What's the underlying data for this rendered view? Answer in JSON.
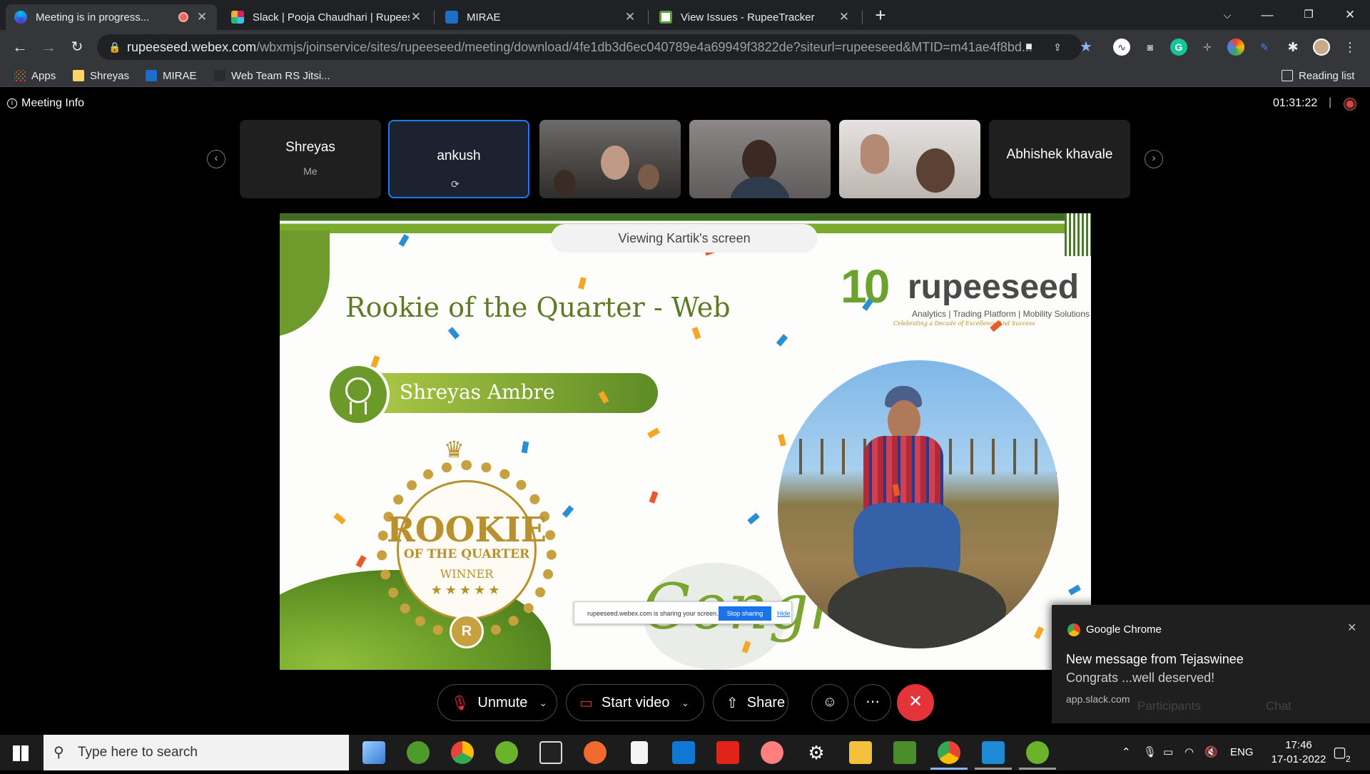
{
  "tabs": [
    {
      "title": "Meeting is in progress...",
      "active": true
    },
    {
      "title": "Slack | Pooja Chaudhari | Rupeese",
      "active": false
    },
    {
      "title": "MIRAE",
      "active": false
    },
    {
      "title": "View Issues - RupeeTracker",
      "active": false
    }
  ],
  "address": {
    "host": "rupeeseed.webex.com",
    "path": "/wbxmjs/joinservice/sites/rupeeseed/meeting/download/4fe1db3d6ec040789e4a69949f3822de?siteurl=rupeeseed&MTID=m41ae4f8bd..."
  },
  "bookmarks": [
    "Apps",
    "Shreyas",
    "MIRAE",
    "Web Team RS Jitsi..."
  ],
  "reading_list": "Reading list",
  "meeting": {
    "info_label": "Meeting Info",
    "timer": "01:31:22",
    "viewing_banner": "Viewing Kartik's screen"
  },
  "participants": [
    {
      "name": "Shreyas",
      "sub": "Me"
    },
    {
      "name": "ankush",
      "sub": ""
    },
    {
      "name": "",
      "video": true
    },
    {
      "name": "",
      "video": true
    },
    {
      "name": "",
      "video": true
    },
    {
      "name": "Abhishek khavale",
      "sub": ""
    }
  ],
  "slide": {
    "title": "Rookie of the Quarter - Web",
    "winner_name": "Shreyas Ambre",
    "badge_main": "ROOKIE",
    "badge_sub": "OF THE QUARTER",
    "badge_winner": "WINNER",
    "brand": "rupeeseed",
    "brand_tagline": "Analytics | Trading Platform | Mobility Solutions",
    "brand_celebrating": "Celebrating a Decade of Excellence And Success",
    "brand_years": "10",
    "congrats": "Congrats",
    "share_notice": "rupeeseed.webex.com is sharing your screen.",
    "stop_sharing": "Stop sharing",
    "hide": "Hide"
  },
  "controls": {
    "unmute": "Unmute",
    "start_video": "Start video",
    "share": "Share"
  },
  "notification": {
    "app": "Google Chrome",
    "title": "New message from Tejaswinee",
    "body": "Congrats ...well deserved!",
    "source": "app.slack.com",
    "behind_left": "Participants",
    "behind_right": "Chat"
  },
  "taskbar": {
    "search_placeholder": "Type here to search",
    "lang": "ENG",
    "time": "17:46",
    "date": "17-01-2022",
    "notif_count": "2"
  },
  "colors": {
    "accent_green": "#7aab2c",
    "gold": "#b8902c",
    "webex_blue": "#1c7bf0",
    "leave_red": "#e5333a"
  }
}
